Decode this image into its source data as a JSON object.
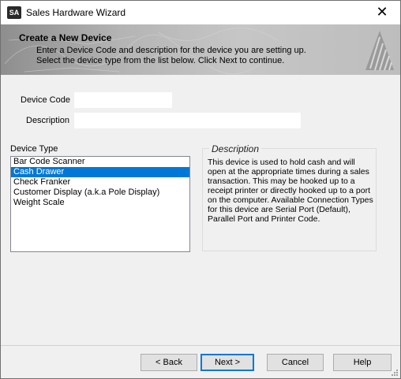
{
  "window": {
    "app_icon_text": "SA",
    "title": "Sales Hardware Wizard",
    "close_glyph": "✕"
  },
  "banner": {
    "title": "Create a New Device",
    "line1": "Enter a Device Code and description for the device you are setting up.",
    "line2": "Select the device type from the list below.  Click Next to continue."
  },
  "form": {
    "device_code_label": "Device Code",
    "device_code_value": "",
    "description_label": "Description",
    "description_value": ""
  },
  "device_type": {
    "label": "Device Type",
    "items": [
      "Bar Code Scanner",
      "Cash Drawer",
      "Check Franker",
      "Customer Display (a.k.a Pole Display)",
      "Weight Scale"
    ],
    "selected_index": 1
  },
  "description_panel": {
    "legend": "Description",
    "text": "This device is used to hold cash and will open at the appropriate times during a sales transaction. This may be hooked up to a receipt printer or directly hooked up to a port on the computer.  Available Connection Types for this device are Serial Port (Default), Parallel Port and Printer Code."
  },
  "buttons": {
    "back": "< Back",
    "next": "Next >",
    "cancel": "Cancel",
    "help": "Help"
  },
  "colors": {
    "selection": "#0078d7",
    "default_button_border": "#0078d7"
  },
  "icons": {
    "close": "close-icon",
    "logo": "triangle-stripes-logo",
    "grip": "resize-grip-icon"
  }
}
